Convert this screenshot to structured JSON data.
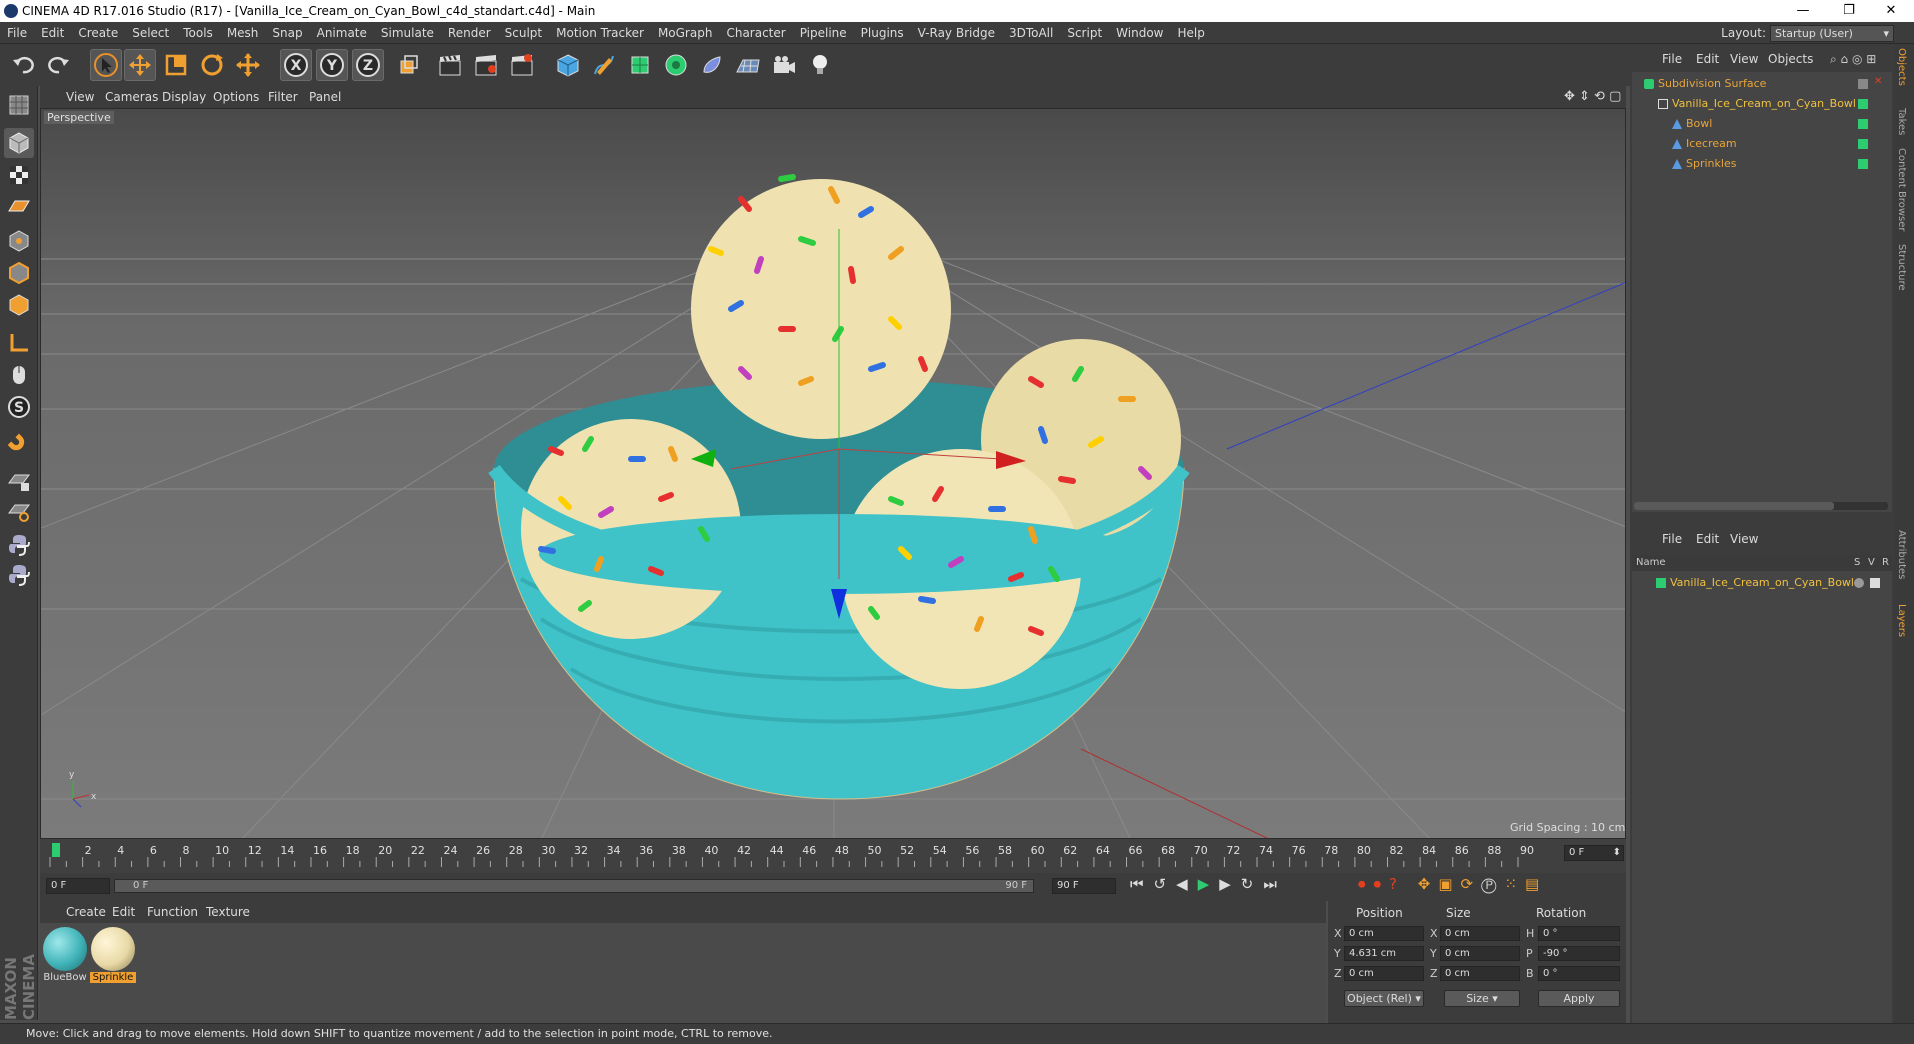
{
  "window": {
    "title": "CINEMA 4D R17.016 Studio (R17) - [Vanilla_Ice_Cream_on_Cyan_Bowl_c4d_standart.c4d] - Main",
    "min": "—",
    "restore": "❐",
    "close": "✕"
  },
  "menu": [
    "File",
    "Edit",
    "Create",
    "Select",
    "Tools",
    "Mesh",
    "Snap",
    "Animate",
    "Simulate",
    "Render",
    "Sculpt",
    "Motion Tracker",
    "MoGraph",
    "Character",
    "Pipeline",
    "Plugins",
    "V-Ray Bridge",
    "3DToAll",
    "Script",
    "Window",
    "Help"
  ],
  "layout": {
    "label": "Layout:",
    "value": "Startup (User)"
  },
  "viewport_menu": [
    "View",
    "Cameras",
    "Display",
    "Options",
    "Filter",
    "Panel"
  ],
  "viewport": {
    "label": "Perspective",
    "grid_spacing": "Grid Spacing : 10 cm"
  },
  "timeline": {
    "ticks": [
      "0",
      "2",
      "4",
      "6",
      "8",
      "10",
      "12",
      "14",
      "16",
      "18",
      "20",
      "22",
      "24",
      "26",
      "28",
      "30",
      "32",
      "34",
      "36",
      "38",
      "40",
      "42",
      "44",
      "46",
      "48",
      "50",
      "52",
      "54",
      "56",
      "58",
      "60",
      "62",
      "64",
      "66",
      "68",
      "70",
      "72",
      "74",
      "76",
      "78",
      "80",
      "82",
      "84",
      "86",
      "88",
      "90"
    ],
    "current_frame": "0 F",
    "start": "0 F",
    "range_start": "0 F",
    "range_end": "90 F",
    "end": "90 F"
  },
  "material_menu": [
    "Create",
    "Edit",
    "Function",
    "Texture"
  ],
  "materials": [
    {
      "name": "BlueBow",
      "color": "#3fb3b8",
      "selected": false
    },
    {
      "name": "Sprinkle",
      "color": "#e8d9a6",
      "selected": true
    }
  ],
  "coords": {
    "headers": {
      "position": "Position",
      "size": "Size",
      "rotation": "Rotation"
    },
    "rows": [
      {
        "axis": "X",
        "pos": "0 cm",
        "size_axis": "X",
        "size": "0 cm",
        "rot_axis": "H",
        "rot": "0 °"
      },
      {
        "axis": "Y",
        "pos": "4.631 cm",
        "size_axis": "Y",
        "size": "0 cm",
        "rot_axis": "P",
        "rot": "-90 °"
      },
      {
        "axis": "Z",
        "pos": "0 cm",
        "size_axis": "Z",
        "size": "0 cm",
        "rot_axis": "B",
        "rot": "0 °"
      }
    ],
    "mode": "Object (Rel)",
    "size_mode": "Size",
    "apply": "Apply"
  },
  "objects_menu": [
    "File",
    "Edit",
    "View",
    "Objects"
  ],
  "objects": [
    {
      "name": "Subdivision Surface",
      "color": "#e8a53a",
      "indent": 0
    },
    {
      "name": "Vanilla_Ice_Cream_on_Cyan_Bowl",
      "color": "#f0c040",
      "indent": 1
    },
    {
      "name": "Bowl",
      "color": "#e8a53a",
      "indent": 2
    },
    {
      "name": "Icecream",
      "color": "#e8a53a",
      "indent": 2
    },
    {
      "name": "Sprinkles",
      "color": "#e8a53a",
      "indent": 2
    }
  ],
  "layers_menu": [
    "File",
    "Edit",
    "View"
  ],
  "layers_header": {
    "name": "Name",
    "s": "S",
    "v": "V",
    "r": "R"
  },
  "layers": [
    {
      "name": "Vanilla_Ice_Cream_on_Cyan_Bowl",
      "color": "#2ecc71"
    }
  ],
  "side_tabs": [
    "Objects",
    "Takes",
    "Content Browser",
    "Structure",
    "Attributes",
    "Layers"
  ],
  "brand": "MAXON CINEMA 4D",
  "status": "Move: Click and drag to move elements. Hold down SHIFT to quantize movement / add to the selection in point mode, CTRL to remove.",
  "colors": {
    "accent": "#f0a030",
    "bowl": "#3fc3c8",
    "icecream": "#efe2b0"
  }
}
